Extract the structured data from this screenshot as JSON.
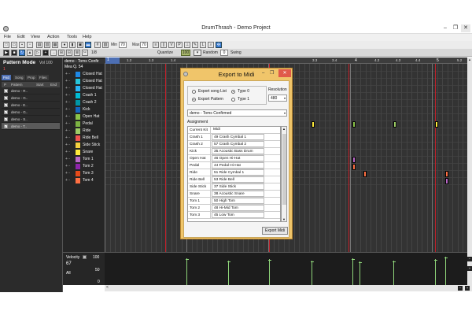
{
  "window": {
    "title": "DrumThrash - Demo Project",
    "min": "–",
    "max": "❐",
    "close": "✕"
  },
  "menu": [
    "File",
    "Edit",
    "View",
    "Action",
    "Tools",
    "Help"
  ],
  "toolbar": {
    "min_label": "Min",
    "min_value": "70",
    "max_label": "Max",
    "max_value": "70",
    "ratio": "1/8",
    "quantize_label": "Quantize",
    "quantize_value": "100",
    "random_label": "Random",
    "random_value": "0",
    "swing_label": "Swing"
  },
  "pattern_panel": {
    "title": "Pattern Mode",
    "vol": "Vol 100",
    "marker": "1",
    "tabs": [
      "Patt",
      "Song",
      "Prop",
      "Files"
    ],
    "headers": [
      "P",
      "Pattern",
      "Start",
      "End"
    ],
    "rows": [
      {
        "name": "demo - R..",
        "checked": true
      },
      {
        "name": "demo - G..",
        "checked": true
      },
      {
        "name": "demo - E..",
        "checked": true
      },
      {
        "name": "demo - G..",
        "checked": true
      },
      {
        "name": "demo - S..",
        "checked": true
      },
      {
        "name": "demo - T..",
        "checked": true
      }
    ]
  },
  "tracks_panel": {
    "pattern_name": "demo - Toms Confir",
    "measure": "Mea Q. 54",
    "tracks": [
      {
        "name": "Closed Hat",
        "color": "#1e88e5"
      },
      {
        "name": "Closed Hat",
        "color": "#26c6da"
      },
      {
        "name": "Closed Hat",
        "color": "#29b6f6"
      },
      {
        "name": "Crash 1",
        "color": "#00bcd4"
      },
      {
        "name": "Crash 2",
        "color": "#0097a7"
      },
      {
        "name": "Kick",
        "color": "#1565c0"
      },
      {
        "name": "Open Hat",
        "color": "#8bc34a"
      },
      {
        "name": "Pedal",
        "color": "#7cb342"
      },
      {
        "name": "Ride",
        "color": "#9ccc65"
      },
      {
        "name": "Ride Bell",
        "color": "#ef5350"
      },
      {
        "name": "Side Stick",
        "color": "#f4d03f"
      },
      {
        "name": "Snare",
        "color": "#ffeb3b"
      },
      {
        "name": "Tom 1",
        "color": "#ba68c8"
      },
      {
        "name": "Tom 2",
        "color": "#8e24aa"
      },
      {
        "name": "Tom 3",
        "color": "#e64a19"
      },
      {
        "name": "Tom 4",
        "color": "#ff7043"
      }
    ]
  },
  "ruler": {
    "first": "1",
    "ticks": [
      "1.2",
      "1.3",
      "1.4",
      "3.3",
      "3.4",
      "4",
      "4.2",
      "4.3",
      "4.4",
      "5",
      "5.2"
    ],
    "major_ticks": [
      "4",
      "5"
    ]
  },
  "velocity": {
    "label": "Velocity",
    "max": "100",
    "current": "67",
    "mid": "50",
    "all": "All",
    "min": "0"
  },
  "dialog": {
    "title": "Export to Midi",
    "opt_song_list": "Export song List",
    "opt_pattern": "Export Pattern",
    "opt_type0": "Type 0",
    "opt_type1": "Type 1",
    "selected_export": "pattern",
    "selected_type": "type0",
    "resolution_label": "Resolution",
    "resolution_value": "480",
    "pattern_select": "demo - Toms Confirmed",
    "assignment_label": "Assignment",
    "table_header": [
      "Current Kit",
      "Midi"
    ],
    "rows": [
      [
        "Crash 1",
        "49 Crash Cymbal 1"
      ],
      [
        "Crash 2",
        "57 Crash Cymbal 2"
      ],
      [
        "Kick",
        "35 Acoustic Bass Drum"
      ],
      [
        "Open Hat",
        "46 Open Hi-Hat"
      ],
      [
        "Pedal",
        "44 Pedal Hi-Hat"
      ],
      [
        "Ride",
        "51 Ride Cymbal 1"
      ],
      [
        "Ride Bell",
        "53 Ride Bell"
      ],
      [
        "Side Stick",
        "37 Side Stick"
      ],
      [
        "Snare",
        "38 Acoustic Snare"
      ],
      [
        "Tom 1",
        "50 High Tom"
      ],
      [
        "Tom 2",
        "48 Hi-Mid Tom"
      ],
      [
        "Tom 3",
        "45 Low Tom"
      ]
    ],
    "export_button": "Export Midi",
    "window_buttons": [
      "–",
      "❐",
      "✕"
    ]
  },
  "hscroll": {
    "left": "<",
    "right": ">"
  }
}
